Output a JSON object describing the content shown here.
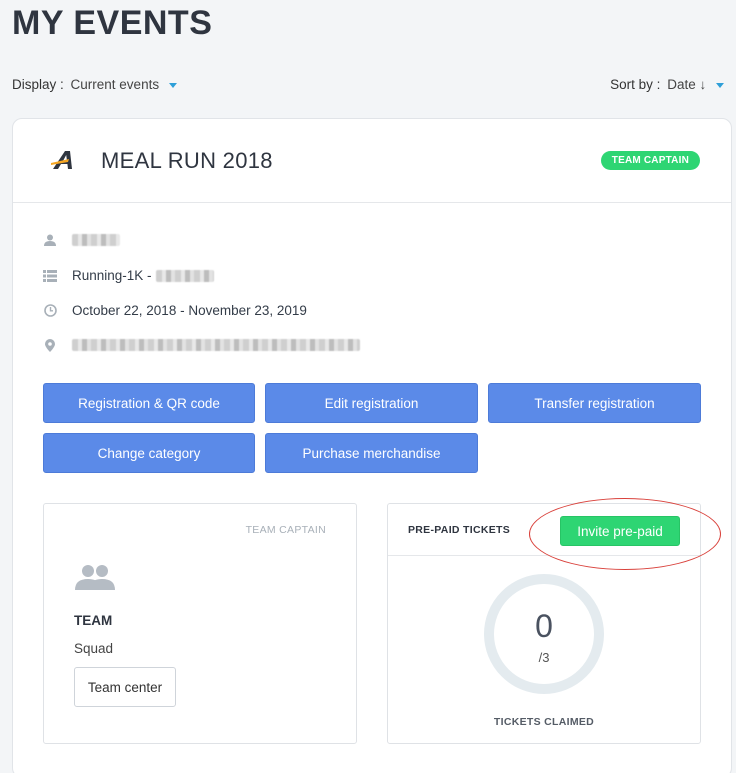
{
  "page": {
    "title": "MY EVENTS"
  },
  "filters": {
    "display_label": "Display :",
    "display_value": "Current events",
    "sort_label": "Sort by :",
    "sort_value": "Date ↓"
  },
  "event": {
    "title": "MEAL RUN 2018",
    "role_badge": "TEAM CAPTAIN",
    "logo_color": "#f5a623",
    "category_prefix": "Running-1K -",
    "dates": "October 22, 2018 - November 23, 2019"
  },
  "actions": {
    "registration_qr": "Registration & QR code",
    "edit_registration": "Edit registration",
    "transfer_registration": "Transfer registration",
    "change_category": "Change category",
    "purchase_merchandise": "Purchase merchandise"
  },
  "team": {
    "role": "TEAM CAPTAIN",
    "label": "TEAM",
    "name": "Squad",
    "center_button": "Team center"
  },
  "tickets": {
    "title": "PRE-PAID TICKETS",
    "invite_button": "Invite pre-paid",
    "claimed": "0",
    "total": "/3",
    "claimed_label": "TICKETS CLAIMED"
  },
  "colors": {
    "primary_button": "#5b8ae8",
    "success": "#2ed573",
    "caret": "#2e9fd8",
    "annotation": "#d9413b"
  }
}
